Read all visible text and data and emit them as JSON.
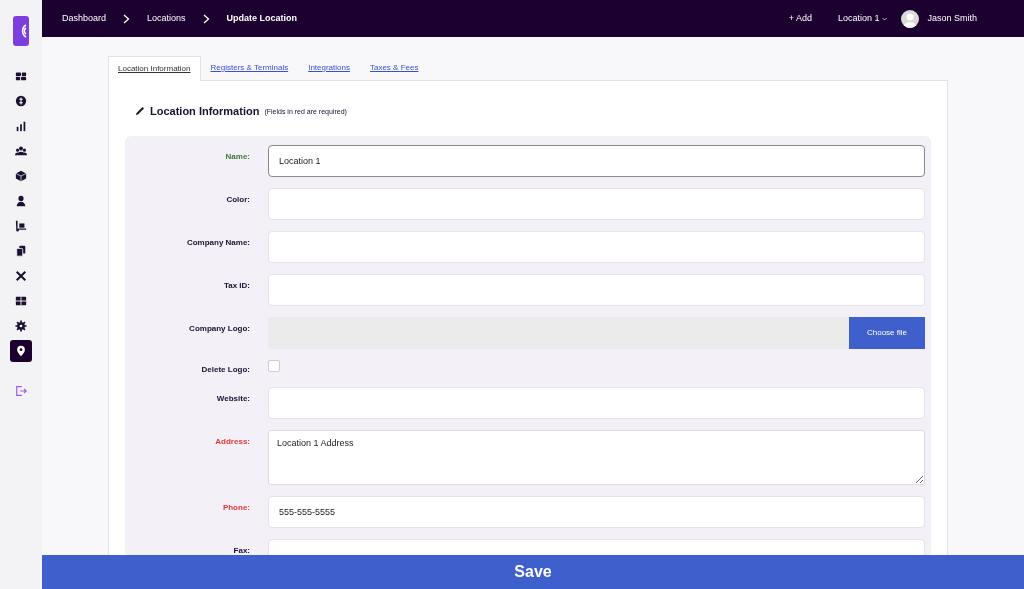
{
  "sidebar": {
    "items": [
      {
        "selected": false
      },
      {
        "selected": false
      },
      {
        "selected": false
      },
      {
        "selected": false
      },
      {
        "selected": false
      },
      {
        "selected": false
      },
      {
        "selected": false
      },
      {
        "selected": false
      },
      {
        "selected": false
      },
      {
        "selected": false
      },
      {
        "selected": false
      },
      {
        "selected": true
      }
    ]
  },
  "breadcrumbs": [
    "Dashboard",
    "Locations",
    "Update Location"
  ],
  "header": {
    "add": "+ Add",
    "location": "Location 1",
    "user": "Jason Smith"
  },
  "tabs": [
    {
      "label": "Location Information",
      "selected": true
    },
    {
      "label": "Registers & Terminals",
      "selected": false
    },
    {
      "label": "Integrations",
      "selected": false
    },
    {
      "label": "Taxes & Fees",
      "selected": false
    }
  ],
  "section": {
    "title": "Location Information",
    "note": "(Fields in red are required)"
  },
  "fields": [
    {
      "kind": "text",
      "label": "Name:",
      "value": "Location 1",
      "required": false,
      "focused": true
    },
    {
      "kind": "text",
      "label": "Color:",
      "required": false,
      "focused": false
    },
    {
      "kind": "text",
      "label": "Company Name:",
      "required": false,
      "focused": false
    },
    {
      "kind": "text",
      "label": "Tax ID:",
      "required": false,
      "focused": false
    },
    {
      "kind": "file",
      "label": "Company Logo:",
      "button": "Choose file",
      "required": false,
      "focused": false
    },
    {
      "kind": "checkbox",
      "label": "Delete Logo:",
      "checked": false,
      "required": false,
      "focused": false
    },
    {
      "kind": "text",
      "label": "Website:",
      "required": false,
      "focused": false
    },
    {
      "kind": "textarea",
      "label": "Address:",
      "value": "Location 1 Address",
      "required": true,
      "focused": false
    },
    {
      "kind": "text",
      "label": "Phone:",
      "value": "555-555-5555",
      "required": true,
      "focused": false
    },
    {
      "kind": "text",
      "label": "Fax:",
      "required": false,
      "focused": false
    }
  ],
  "save_button": "Save"
}
